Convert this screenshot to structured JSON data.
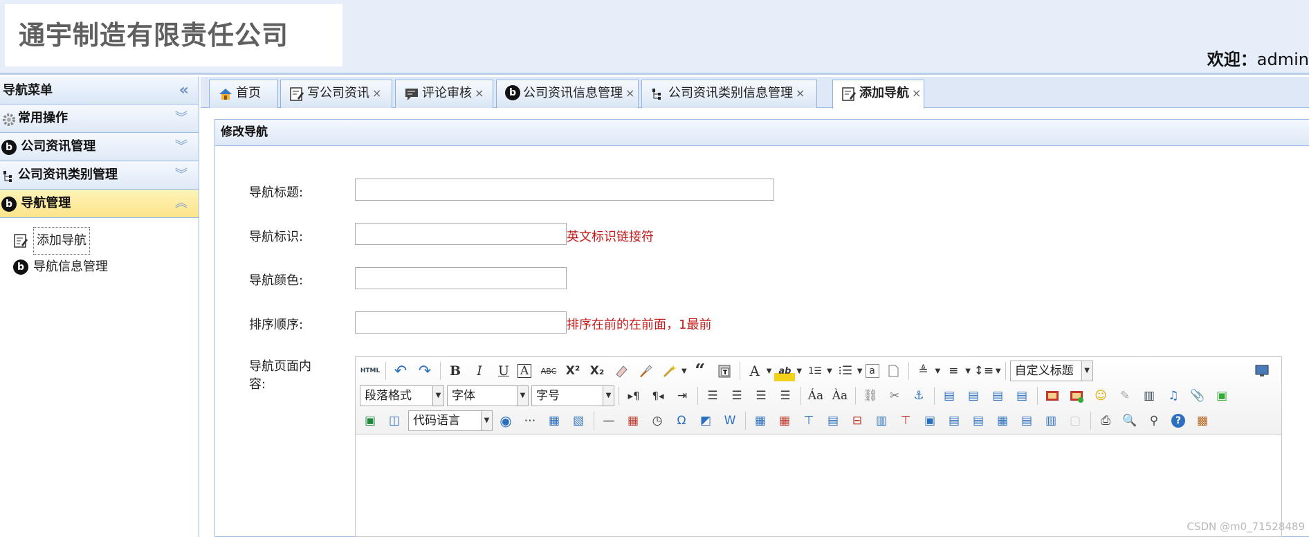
{
  "header": {
    "company": "通宇制造有限责任公司",
    "welcome_label": "欢迎：",
    "user": "admin"
  },
  "sidebar": {
    "title": "导航菜单",
    "collapse_icon": "double-chevron-left-icon",
    "groups": [
      {
        "label": "常用操作",
        "icon": "gear-icon",
        "state": "collapsed"
      },
      {
        "label": "公司资讯管理",
        "icon": "b-circle-icon",
        "state": "collapsed"
      },
      {
        "label": "公司资讯类别管理",
        "icon": "tree-icon",
        "state": "collapsed"
      },
      {
        "label": "导航管理",
        "icon": "b-circle-icon",
        "state": "expanded"
      }
    ],
    "items": [
      {
        "label": "添加导航",
        "icon": "edit-doc-icon",
        "selected": true
      },
      {
        "label": "导航信息管理",
        "icon": "b-circle-icon",
        "selected": false
      }
    ]
  },
  "tabs": [
    {
      "label": "首页",
      "icon": "home-icon",
      "closable": false
    },
    {
      "label": "写公司资讯",
      "icon": "edit-doc-icon",
      "closable": true
    },
    {
      "label": "评论审核",
      "icon": "comment-icon",
      "closable": true
    },
    {
      "label": "公司资讯信息管理",
      "icon": "b-circle-icon",
      "closable": true
    },
    {
      "label": "公司资讯类别信息管理",
      "icon": "tree-icon",
      "closable": true
    },
    {
      "label": "添加导航",
      "icon": "edit-doc-icon",
      "closable": true,
      "active": true
    }
  ],
  "close_glyph": "×",
  "panel": {
    "title": "修改导航"
  },
  "form": {
    "title_label": "导航标题:",
    "title_value": "",
    "key_label": "导航标识:",
    "key_value": "",
    "key_hint": "英文标识链接符",
    "color_label": "导航颜色:",
    "color_value": "",
    "order_label": "排序顺序:",
    "order_value": "",
    "order_hint": "排序在前的在前面，1最前",
    "content_label": "导航页面内容:"
  },
  "editor": {
    "custom_title": "自定义标题",
    "paragraph": "段落格式",
    "font": "字体",
    "size": "字号",
    "code_lang": "代码语言"
  },
  "watermark": "CSDN @m0_71528489",
  "colors": {
    "header_bg": "#e6eefa",
    "active_group": "#fbe48a",
    "hint_red": "#c41a1a",
    "border_blue": "#99bbe8"
  }
}
